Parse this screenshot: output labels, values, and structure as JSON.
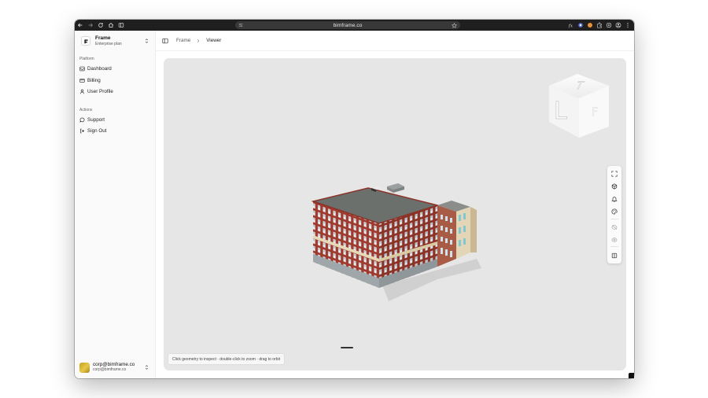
{
  "browser": {
    "url": "bimframe.co",
    "nav_icons": [
      "back-arrow-icon",
      "forward-arrow-icon",
      "reload-icon",
      "home-icon",
      "sidebar-panel-icon"
    ],
    "extension_icons": [
      "fx-extension-icon",
      "extension-icon-blue",
      "extension-icon-orange",
      "puzzle-icon",
      "extension-icon",
      "profile-icon",
      "more-vertical-icon"
    ]
  },
  "sidebar": {
    "brand": {
      "title": "Frame",
      "subtitle": "Enterprise plan"
    },
    "groups": [
      {
        "label": "Platform",
        "items": [
          {
            "label": "Dashboard",
            "icon": "dashboard-icon"
          },
          {
            "label": "Billing",
            "icon": "credit-card-icon"
          },
          {
            "label": "User Profile",
            "icon": "user-icon"
          }
        ]
      },
      {
        "label": "Actions",
        "items": [
          {
            "label": "Support",
            "icon": "chat-bubble-icon"
          },
          {
            "label": "Sign Out",
            "icon": "sign-out-icon"
          }
        ]
      }
    ],
    "user": {
      "name": "corp@bimframe.co",
      "email": "corp@bimframe.co"
    }
  },
  "header": {
    "breadcrumb": [
      "Frame",
      "Viewer"
    ]
  },
  "viewer": {
    "navcube_labels": [
      "T",
      "L",
      "F"
    ],
    "tools": [
      "fullscreen-icon",
      "cube-icon",
      "bell-icon",
      "palette-icon",
      "eye-off-icon",
      "eye-icon",
      "split-panel-icon"
    ],
    "hint": "Click geometry to inspect · double-click to zoom · drag to orbit"
  },
  "colors": {
    "viewer_bg": "#e6e6e6",
    "chrome_bg": "#1f1f1f",
    "brick": "#9e3b2e",
    "roof": "#6c706c"
  }
}
